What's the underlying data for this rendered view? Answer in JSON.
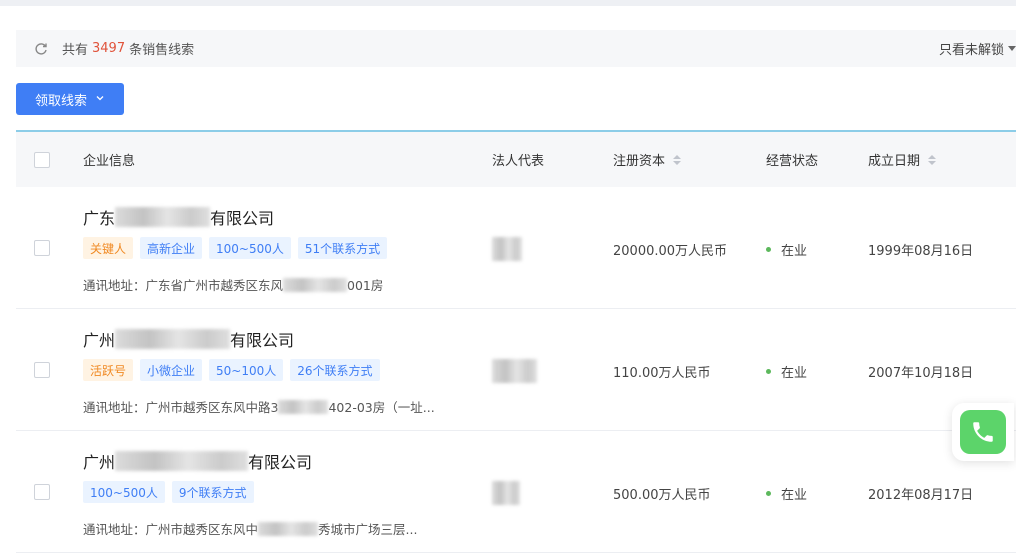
{
  "summary": {
    "prefix": "共有",
    "count": "3497",
    "suffix": "条销售线索",
    "filter_label": "只看未解锁"
  },
  "claim_button": {
    "label": "领取线索"
  },
  "columns": {
    "company": "企业信息",
    "legal_rep": "法人代表",
    "capital": "注册资本",
    "status": "经营状态",
    "founded": "成立日期"
  },
  "rows": [
    {
      "name_prefix": "广东",
      "name_suffix": "有限公司",
      "tags": [
        "关键人",
        "高新企业",
        "100~500人",
        "51个联系方式"
      ],
      "address_prefix": "通讯地址：广东省广州市越秀区东风",
      "address_suffix": "001房",
      "capital": "20000.00万人民币",
      "status": "在业",
      "founded": "1999年08月16日"
    },
    {
      "name_prefix": "广州",
      "name_suffix": "有限公司",
      "tags": [
        "活跃号",
        "小微企业",
        "50~100人",
        "26个联系方式"
      ],
      "address_prefix": "通讯地址：广州市越秀区东风中路3",
      "address_suffix": "402-03房（一址...",
      "capital": "110.00万人民币",
      "status": "在业",
      "founded": "2007年10月18日"
    },
    {
      "name_prefix": "广州",
      "name_suffix": "有限公司",
      "tags": [
        "100~500人",
        "9个联系方式"
      ],
      "address_prefix": "通讯地址：广州市越秀区东风中",
      "address_suffix": "秀城市广场三层...",
      "capital": "500.00万人民币",
      "status": "在业",
      "founded": "2012年08月17日"
    }
  ],
  "icons": {
    "refresh": "refresh-icon",
    "phone": "phone-icon",
    "chevron": "chevron-down-icon"
  },
  "colors": {
    "primary": "#3f7ef5",
    "count": "#e0533b",
    "status_dot": "#5cb85c",
    "phone_green": "#5cd46a"
  }
}
